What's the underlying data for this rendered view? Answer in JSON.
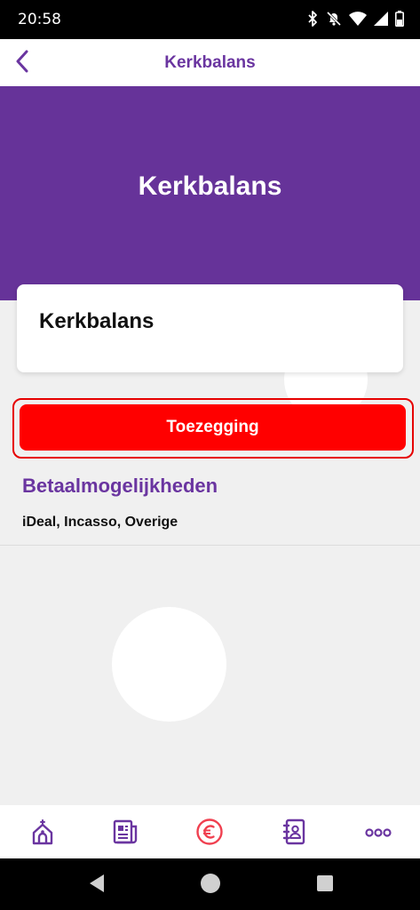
{
  "status_bar": {
    "time": "20:58",
    "icons": [
      "bluetooth-icon",
      "bell-off-icon",
      "wifi-icon",
      "signal-icon",
      "battery-icon"
    ]
  },
  "header": {
    "title": "Kerkbalans",
    "back_icon": "chevron-left-icon"
  },
  "hero": {
    "title": "Kerkbalans"
  },
  "card": {
    "title": "Kerkbalans"
  },
  "actions": {
    "pledge_label": "Toezegging"
  },
  "payment": {
    "title": "Betaalmogelijkheden",
    "methods": "iDeal, Incasso, Overige"
  },
  "tab_bar": {
    "tabs": [
      {
        "icon": "church-icon"
      },
      {
        "icon": "news-icon"
      },
      {
        "icon": "euro-icon",
        "active": true
      },
      {
        "icon": "contacts-icon"
      },
      {
        "icon": "more-icon"
      }
    ]
  },
  "colors": {
    "brand_purple": "#663399",
    "accent_red": "#ff0000",
    "background": "#f0f0f0"
  }
}
